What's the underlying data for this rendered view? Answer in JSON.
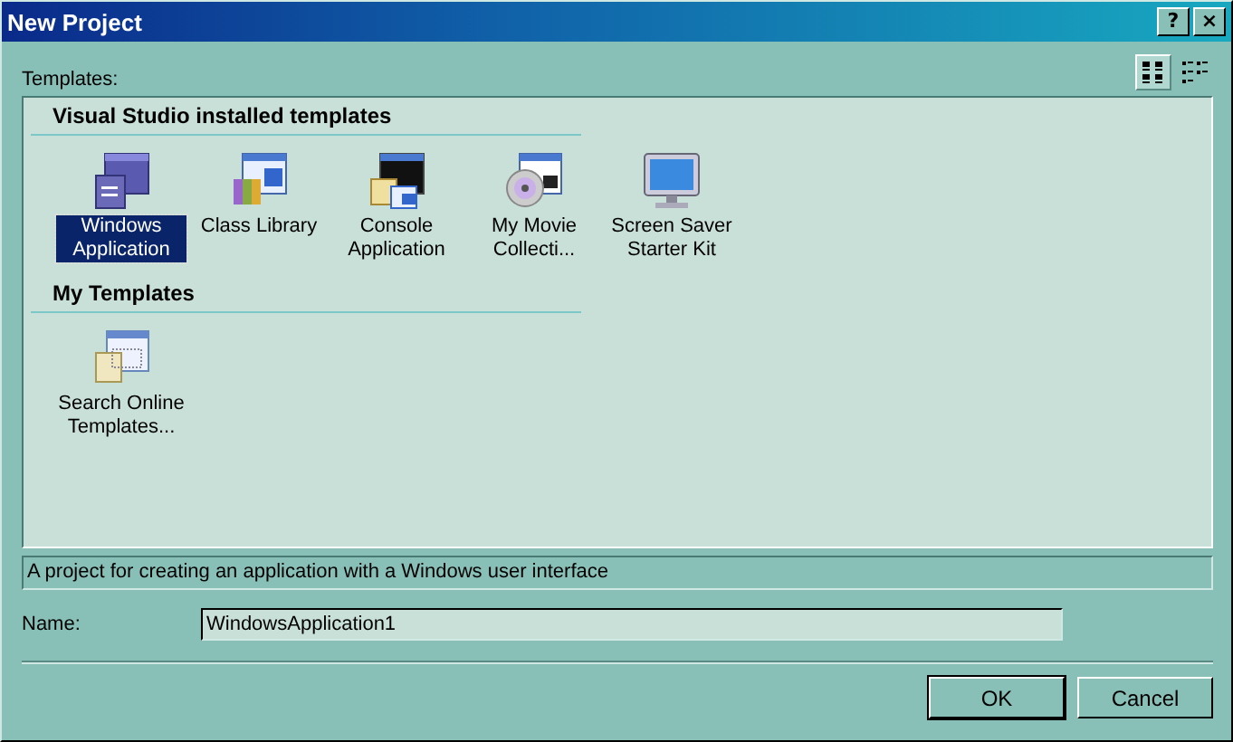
{
  "window": {
    "title": "New Project",
    "buttons": [
      "?",
      "×"
    ]
  },
  "templates_label": "Templates:",
  "view_buttons": [
    {
      "kind": "large",
      "selected": true
    },
    {
      "kind": "small",
      "selected": false
    }
  ],
  "groups": [
    {
      "title": "Visual Studio installed templates",
      "items": [
        {
          "label": "Windows Application",
          "kind": "windows",
          "selected": true
        },
        {
          "label": "Class Library",
          "kind": "library",
          "selected": false
        },
        {
          "label": "Console Application",
          "kind": "console",
          "selected": false
        },
        {
          "label": "My Movie Collecti...",
          "kind": "movie",
          "selected": false
        },
        {
          "label": "Screen Saver Starter Kit",
          "kind": "screensaver",
          "selected": false
        }
      ]
    },
    {
      "title": "My Templates",
      "items": [
        {
          "label": "Search Online Templates...",
          "kind": "online",
          "selected": false
        }
      ]
    }
  ],
  "description": "A project for creating an application with a Windows user interface",
  "name_field": {
    "label": "Name:",
    "value": "WindowsApplication1"
  },
  "buttons": [
    {
      "label": "OK",
      "default": true
    },
    {
      "label": "Cancel",
      "default": false
    }
  ]
}
